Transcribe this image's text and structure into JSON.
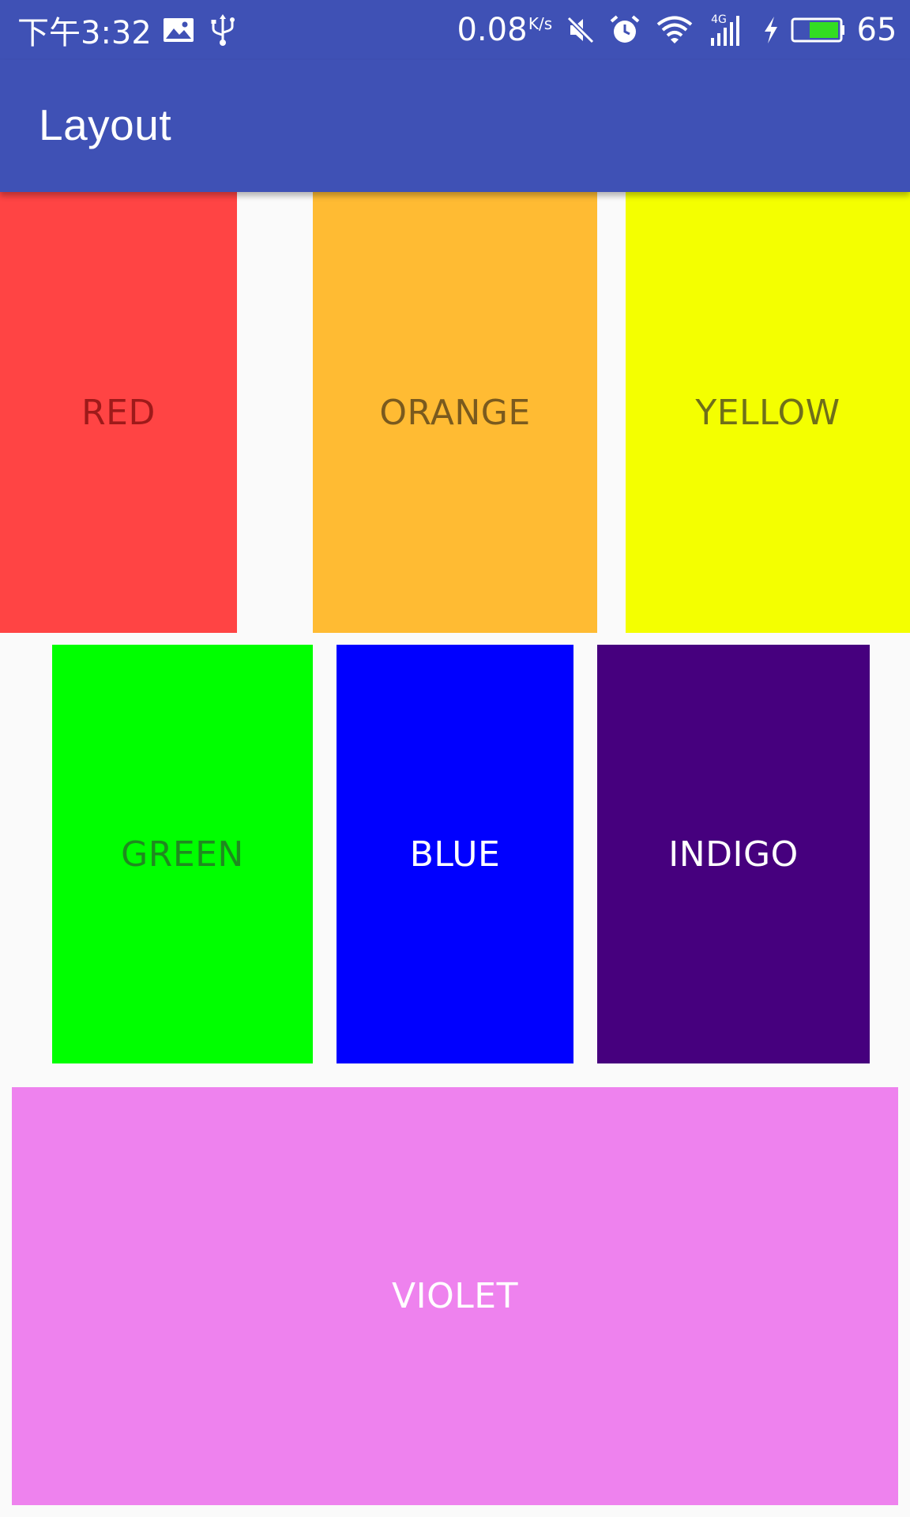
{
  "status_bar": {
    "time": "下午3:32",
    "network_speed": "0.08",
    "network_speed_unit": "K/s",
    "network_type": "4G",
    "battery_level": "65",
    "icons": [
      "image-icon",
      "usb-icon",
      "mute-icon",
      "alarm-icon",
      "wifi-icon",
      "signal-icon",
      "charging-icon",
      "battery-icon"
    ],
    "background_color": "#3f51b5"
  },
  "app_bar": {
    "title": "Layout",
    "background_color": "#3f51b5"
  },
  "blocks": [
    {
      "label": "RED",
      "color": "#ff4444",
      "text_color": "#9e1a1a"
    },
    {
      "label": "ORANGE",
      "color": "#ffbb33",
      "text_color": "#7a5a1e"
    },
    {
      "label": "YELLOW",
      "color": "#f4ff00",
      "text_color": "#6f6f1a"
    },
    {
      "label": "GREEN",
      "color": "#00ff00",
      "text_color": "#1f8a1f"
    },
    {
      "label": "BLUE",
      "color": "#0000ff",
      "text_color": "#ffffff"
    },
    {
      "label": "INDIGO",
      "color": "#46007e",
      "text_color": "#ffffff"
    },
    {
      "label": "VIOLET",
      "color": "#ee82ee",
      "text_color": "#ffffff"
    }
  ]
}
